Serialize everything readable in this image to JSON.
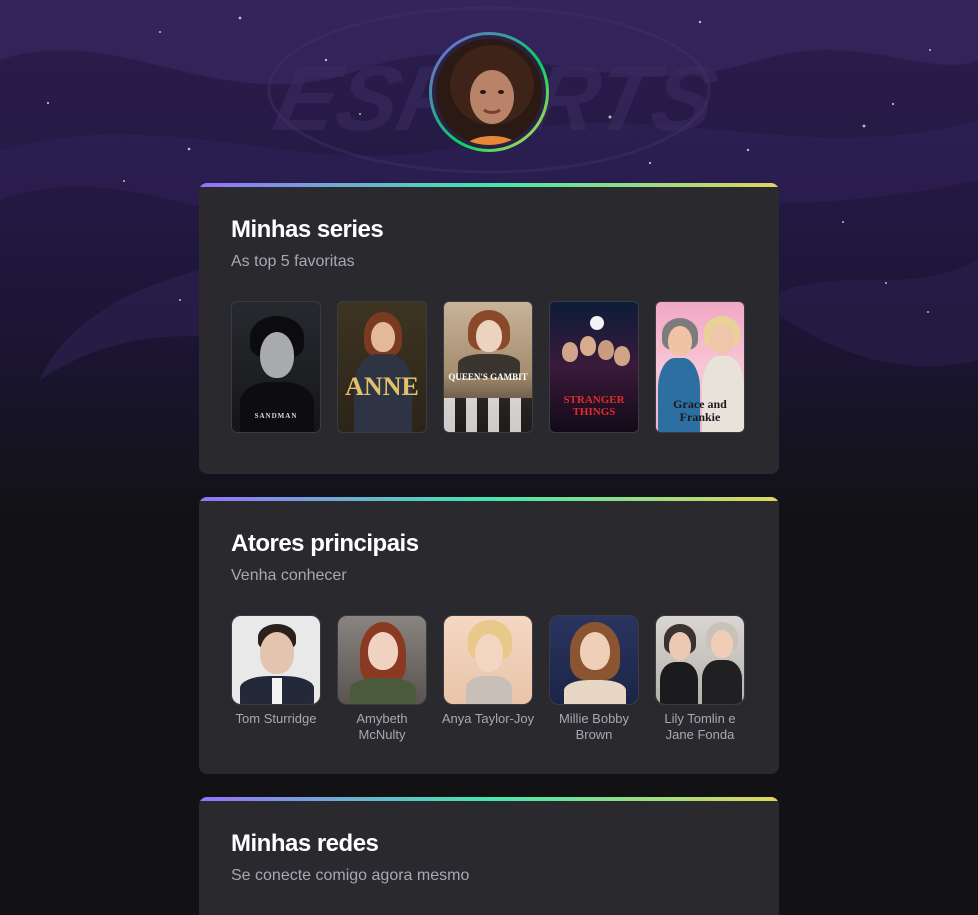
{
  "profile": {
    "avatar_alt": "Foto de perfil",
    "background_text": "ESPORTS"
  },
  "sections": [
    {
      "title": "Minhas series",
      "subtitle": "As top 5 favoritas",
      "items": [
        {
          "label": "SANDMAN"
        },
        {
          "label": "ANNE"
        },
        {
          "label": "QUEEN'S GAMBIT"
        },
        {
          "label": "STRANGER THINGS"
        },
        {
          "label": "Grace and Frankie"
        }
      ]
    },
    {
      "title": "Atores principais",
      "subtitle": "Venha conhecer",
      "items": [
        {
          "name": "Tom Sturridge"
        },
        {
          "name": "Amybeth McNulty"
        },
        {
          "name": "Anya Taylor-Joy"
        },
        {
          "name": "Millie Bobby Brown"
        },
        {
          "name": "Lily Tomlin e Jane Fonda"
        }
      ]
    },
    {
      "title": "Minhas redes",
      "subtitle": "Se conecte comigo agora mesmo"
    }
  ],
  "colors": {
    "accent_start": "#9572fc",
    "accent_mid": "#43e7ad",
    "accent_end": "#e1d55d",
    "card_bg": "#29292e",
    "page_bg": "#121214"
  }
}
